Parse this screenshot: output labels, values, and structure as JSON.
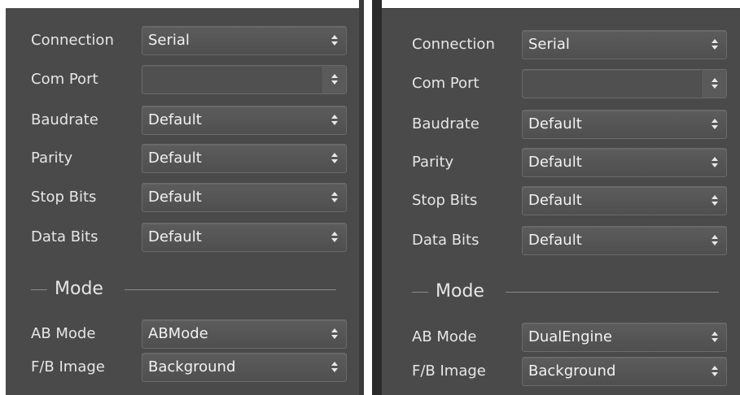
{
  "panels": [
    {
      "connection": {
        "label": "Connection",
        "value": "Serial"
      },
      "com_port": {
        "label": "Com Port",
        "value": ""
      },
      "baudrate": {
        "label": "Baudrate",
        "value": "Default"
      },
      "parity": {
        "label": "Parity",
        "value": "Default"
      },
      "stop_bits": {
        "label": "Stop Bits",
        "value": "Default"
      },
      "data_bits": {
        "label": "Data Bits",
        "value": "Default"
      },
      "mode_section": "Mode",
      "ab_mode": {
        "label": "AB Mode",
        "value": "ABMode"
      },
      "fb_image": {
        "label": "F/B Image",
        "value": "Background"
      }
    },
    {
      "connection": {
        "label": "Connection",
        "value": "Serial"
      },
      "com_port": {
        "label": "Com Port",
        "value": ""
      },
      "baudrate": {
        "label": "Baudrate",
        "value": "Default"
      },
      "parity": {
        "label": "Parity",
        "value": "Default"
      },
      "stop_bits": {
        "label": "Stop Bits",
        "value": "Default"
      },
      "data_bits": {
        "label": "Data Bits",
        "value": "Default"
      },
      "mode_section": "Mode",
      "ab_mode": {
        "label": "AB Mode",
        "value": "DualEngine"
      },
      "fb_image": {
        "label": "F/B Image",
        "value": "Background"
      }
    }
  ],
  "icons": {
    "dropdown": "chevron-up-down-icon"
  },
  "colors": {
    "panel_bg": "#4a4a4a",
    "text": "#e6e6e6",
    "field_bg": "#555555"
  }
}
